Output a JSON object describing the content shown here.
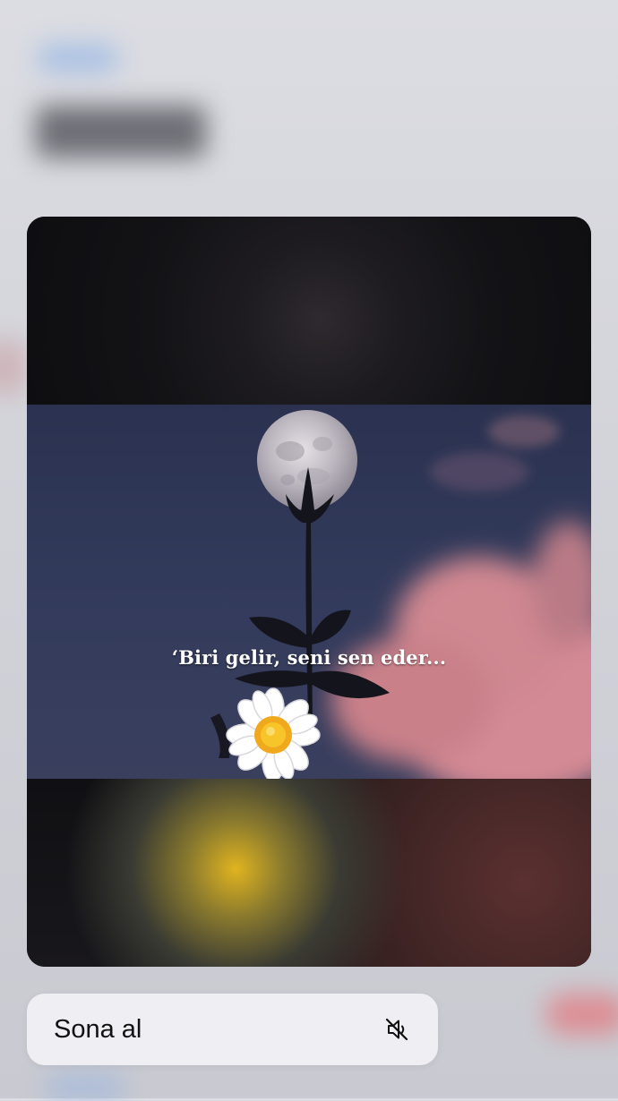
{
  "preview": {
    "caption": "‘Biri gelir, seni sen eder..."
  },
  "menu": {
    "items": [
      {
        "label": "Sona al",
        "icon": "speaker-muted-icon"
      }
    ]
  }
}
